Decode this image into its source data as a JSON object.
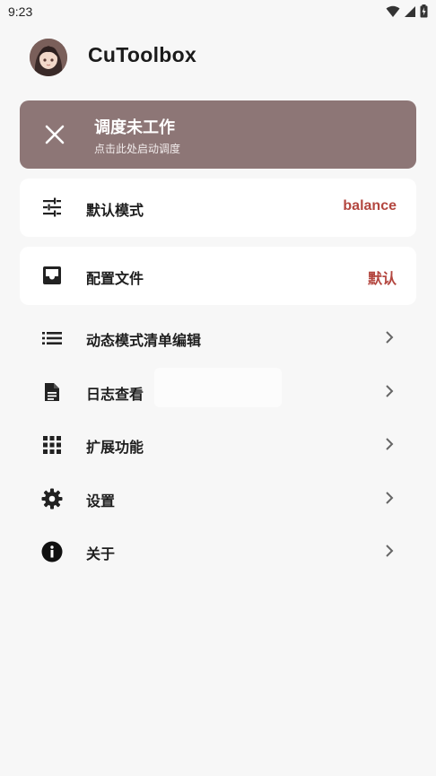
{
  "status_bar": {
    "time": "9:23"
  },
  "header": {
    "app_title": "CuToolbox"
  },
  "banner": {
    "title": "调度未工作",
    "subtitle": "点击此处启动调度"
  },
  "cards": [
    {
      "label": "默认模式",
      "value": "balance",
      "icon": "tune-icon"
    },
    {
      "label": "配置文件",
      "value": "默认",
      "icon": "inbox-icon"
    }
  ],
  "menu": [
    {
      "label": "动态模式清单编辑",
      "icon": "list-icon"
    },
    {
      "label": "日志查看",
      "icon": "document-icon"
    },
    {
      "label": "扩展功能",
      "icon": "apps-grid-icon"
    },
    {
      "label": "设置",
      "icon": "gear-icon"
    },
    {
      "label": "关于",
      "icon": "info-icon"
    }
  ],
  "colors": {
    "banner_bg": "#8d7676",
    "accent_value": "#b3463f",
    "background": "#f7f7f7"
  }
}
